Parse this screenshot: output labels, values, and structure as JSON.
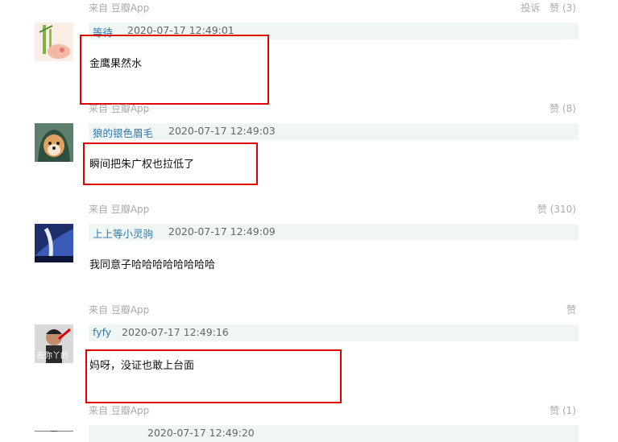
{
  "comments": [
    {
      "source": "来自 豆瓣App",
      "report": "投诉",
      "likes": "赞 (3)",
      "user": "等待",
      "time": "2020-07-17 12:49:01",
      "text": "金鹰果然水",
      "avatar_icon": "bamboo-avatar-icon"
    },
    {
      "source": "来自 豆瓣App",
      "likes": "赞 (8)",
      "user": "狼的银色眉毛",
      "time": "2020-07-17 12:49:03",
      "text": "瞬间把朱广权也拉低了",
      "avatar_icon": "shiba-dog-avatar-icon"
    },
    {
      "source": "来自 豆瓣App",
      "likes": "赞 (310)",
      "user": "上上等小灵驹",
      "time": "2020-07-17 12:49:09",
      "text": "我同意子哈哈哈哈哈哈哈哈",
      "avatar_icon": "blue-abstract-avatar-icon"
    },
    {
      "source": "来自 豆瓣App",
      "likes": "赞",
      "user": "fyfy",
      "time": "2020-07-17 12:49:16",
      "text": "妈呀，没证也敢上台面",
      "avatar_icon": "meme-avatar-icon",
      "avatar_caption": "去你丫的"
    },
    {
      "source": "来自 豆瓣App",
      "likes": "赞 (1)",
      "time": "2020-07-17 12:49:20"
    }
  ],
  "colors": {
    "username": "#3377aa",
    "meta": "#aaaaaa",
    "header_bg": "#f0f6f3",
    "highlight_box": "#e00000"
  }
}
